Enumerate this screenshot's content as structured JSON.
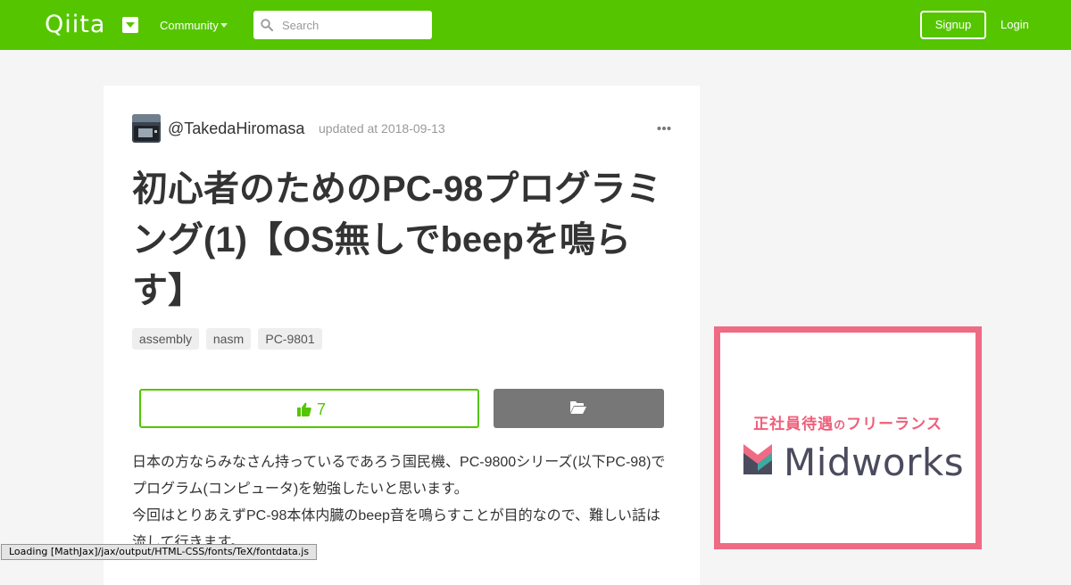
{
  "header": {
    "logo_text": "Qiita",
    "community_label": "Community",
    "search_placeholder": "Search",
    "signup_label": "Signup",
    "login_label": "Login",
    "brand_color": "#55c500"
  },
  "article": {
    "author": "@TakedaHiromasa",
    "updated_text": "updated at 2018-09-13",
    "title": "初心者のためのPC-98プログラミング(1)【OS無しでbeepを鳴らす】",
    "tags": [
      "assembly",
      "nasm",
      "PC-9801"
    ],
    "like_count": "7",
    "body_lines": [
      "日本の方ならみなさん持っているであろう国民機、PC-9800シリーズ(以下PC-98)で",
      "プログラム(コンピュータ)を勉強したいと思います。",
      "今回はとりあえずPC-98本体内臓のbeep音を鳴らすことが目的なので、難しい話は",
      "流して行きます。"
    ]
  },
  "ad": {
    "tagline_main1": "正社員待遇",
    "tagline_small": "の",
    "tagline_main2": "フリーランス",
    "brand": "Midworks",
    "accent_color": "#ef6b85"
  },
  "status_bar": {
    "text": "Loading [MathJax]/jax/output/HTML-CSS/fonts/TeX/fontdata.js"
  }
}
